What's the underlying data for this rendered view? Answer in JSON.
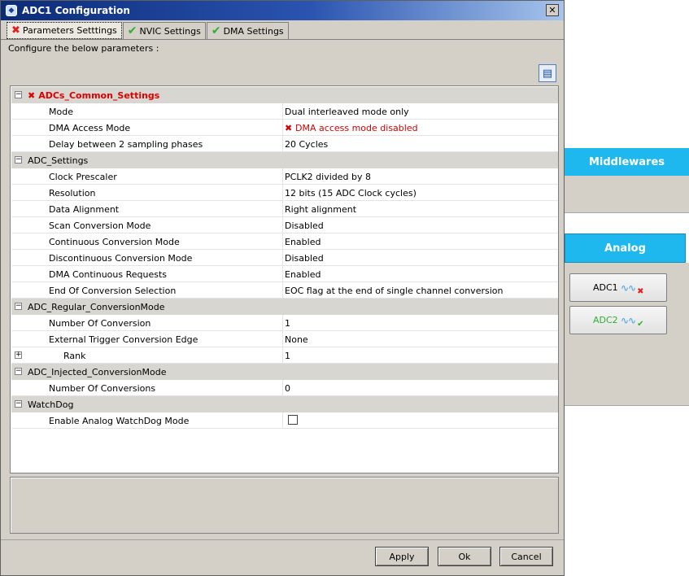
{
  "window": {
    "title": "ADC1 Configuration",
    "close_glyph": "✕"
  },
  "tabs": [
    {
      "label": "Parameters Setttings",
      "status": "error"
    },
    {
      "label": "NVIC Settings",
      "status": "ok"
    },
    {
      "label": "DMA Settings",
      "status": "ok"
    }
  ],
  "configure_label": "Configure the below parameters :",
  "grid": {
    "sections": [
      {
        "title": "ADCs_Common_Settings",
        "status": "error",
        "rows": [
          {
            "name": "Mode",
            "value": "Dual interleaved mode only"
          },
          {
            "name": "DMA Access Mode",
            "value": "DMA access mode disabled",
            "error": true
          },
          {
            "name": "Delay between 2 sampling phases",
            "value": "20 Cycles"
          }
        ]
      },
      {
        "title": "ADC_Settings",
        "rows": [
          {
            "name": "Clock Prescaler",
            "value": "PCLK2 divided by 8"
          },
          {
            "name": "Resolution",
            "value": "12 bits (15 ADC Clock cycles)"
          },
          {
            "name": "Data Alignment",
            "value": "Right alignment"
          },
          {
            "name": "Scan Conversion Mode",
            "value": "Disabled"
          },
          {
            "name": "Continuous Conversion Mode",
            "value": "Enabled"
          },
          {
            "name": "Discontinuous Conversion Mode",
            "value": "Disabled"
          },
          {
            "name": "DMA Continuous Requests",
            "value": "Enabled"
          },
          {
            "name": "End Of Conversion Selection",
            "value": "EOC flag at the end of single channel conversion"
          }
        ]
      },
      {
        "title": "ADC_Regular_ConversionMode",
        "rows": [
          {
            "name": "Number Of Conversion",
            "value": "1"
          },
          {
            "name": "External Trigger Conversion Edge",
            "value": "None"
          },
          {
            "name": "Rank",
            "value": "1",
            "expandable": true
          }
        ]
      },
      {
        "title": "ADC_Injected_ConversionMode",
        "rows": [
          {
            "name": "Number Of Conversions",
            "value": "0"
          }
        ]
      },
      {
        "title": "WatchDog",
        "rows": [
          {
            "name": "Enable Analog WatchDog Mode",
            "checkbox": true,
            "checked": false
          }
        ]
      }
    ]
  },
  "buttons": {
    "apply": "Apply",
    "ok": "Ok",
    "cancel": "Cancel"
  },
  "side_panel": {
    "middlewares": "Middlewares",
    "analog": "Analog",
    "adc1": {
      "label": "ADC1",
      "status": "error"
    },
    "adc2": {
      "label": "ADC2",
      "status": "ok"
    }
  },
  "colors": {
    "accent": "#1eb8ee",
    "error": "#e00000",
    "ok": "#2fae2f"
  }
}
